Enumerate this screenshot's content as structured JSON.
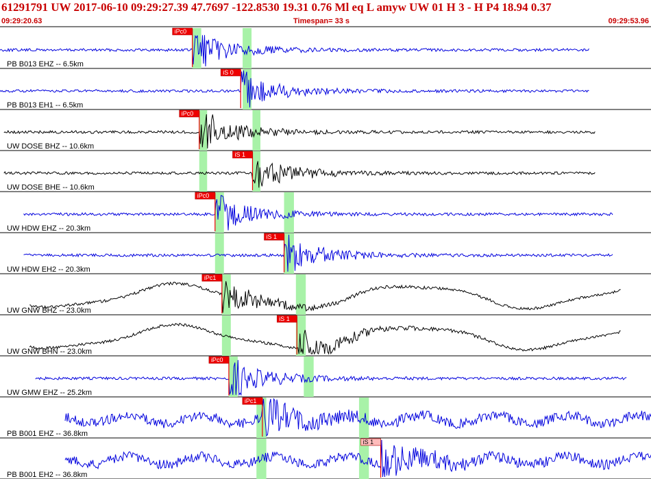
{
  "header": {
    "title": "61291791 UW 2017-06-10 09:29:27.39   47.7697 -122.8530  19.31  0.76 Ml  eq  L amyw     UW 01  H   3  -  H P4   18.94  0.37",
    "start_time": "09:29:20.63",
    "timespan": "Timespan=  33 s",
    "end_time": "09:29:53.96"
  },
  "colors": {
    "blue": "#0000dd",
    "black": "#000000",
    "pick_red": "#ee0000",
    "pick_pink": "#ffbbbb",
    "green_band": "#a8f2a8",
    "header_red": "#c80000"
  },
  "chart_data": {
    "type": "seismogram",
    "time_start": "09:29:20.63",
    "time_end": "09:29:53.96",
    "timespan_s": 33,
    "traces": [
      {
        "label": "PB B013 EHZ -- 6.5km",
        "color": "blue",
        "trace_start_s": 0.0,
        "trace_end_s": 29.9,
        "picks": [
          {
            "label": "iPc0",
            "t": 9.75,
            "style": "red"
          }
        ],
        "windows": [
          [
            9.75,
            10.2
          ],
          [
            12.3,
            12.75
          ]
        ]
      },
      {
        "label": "PB B013 EH1 -- 6.5km",
        "color": "blue",
        "trace_start_s": 0.0,
        "trace_end_s": 29.9,
        "picks": [
          {
            "label": "iS 0",
            "t": 12.2,
            "style": "red"
          }
        ],
        "windows": [
          [
            12.3,
            12.75
          ]
        ]
      },
      {
        "label": "UW DOSE BHZ -- 10.6km",
        "color": "black",
        "trace_start_s": 0.2,
        "trace_end_s": 30.2,
        "picks": [
          {
            "label": "iPc0",
            "t": 10.1,
            "style": "red"
          }
        ],
        "windows": [
          [
            10.1,
            10.5
          ],
          [
            12.8,
            13.2
          ]
        ]
      },
      {
        "label": "UW DOSE BHE -- 10.6km",
        "color": "black",
        "trace_start_s": 0.2,
        "trace_end_s": 30.2,
        "picks": [
          {
            "label": "iS 1",
            "t": 12.8,
            "style": "red"
          }
        ],
        "windows": [
          [
            10.1,
            10.5
          ],
          [
            12.8,
            13.2
          ]
        ]
      },
      {
        "label": "UW HDW EHZ -- 20.3km",
        "color": "blue",
        "trace_start_s": 1.2,
        "trace_end_s": 31.1,
        "picks": [
          {
            "label": "iPc0",
            "t": 10.9,
            "style": "red"
          }
        ],
        "windows": [
          [
            10.9,
            11.35
          ],
          [
            14.4,
            14.9
          ]
        ]
      },
      {
        "label": "UW HDW EH2 -- 20.3km",
        "color": "blue",
        "trace_start_s": 1.2,
        "trace_end_s": 31.1,
        "picks": [
          {
            "label": "iS 1",
            "t": 14.4,
            "style": "red"
          }
        ],
        "windows": [
          [
            10.9,
            11.35
          ],
          [
            14.4,
            14.9
          ]
        ]
      },
      {
        "label": "UW GNW BHZ -- 23.0km",
        "color": "black",
        "trace_start_s": 1.5,
        "trace_end_s": 31.5,
        "picks": [
          {
            "label": "iPc1",
            "t": 11.25,
            "style": "red"
          }
        ],
        "windows": [
          [
            11.25,
            11.7
          ],
          [
            15.0,
            15.5
          ]
        ]
      },
      {
        "label": "UW GNW BHN -- 23.0km",
        "color": "black",
        "trace_start_s": 1.5,
        "trace_end_s": 31.5,
        "picks": [
          {
            "label": "iS 1",
            "t": 15.05,
            "style": "red"
          }
        ],
        "windows": [
          [
            11.25,
            11.7
          ],
          [
            15.0,
            15.5
          ]
        ]
      },
      {
        "label": "UW GMW EHZ -- 25.2km",
        "color": "blue",
        "trace_start_s": 1.8,
        "trace_end_s": 31.8,
        "picks": [
          {
            "label": "iPc0",
            "t": 11.6,
            "style": "red"
          }
        ],
        "windows": [
          [
            11.6,
            12.05
          ],
          [
            15.4,
            15.9
          ]
        ]
      },
      {
        "label": "PB B001 EHZ -- 36.8km",
        "color": "blue",
        "trace_start_s": 3.3,
        "trace_end_s": 33.2,
        "picks": [
          {
            "label": "iPc1",
            "t": 13.3,
            "style": "red"
          }
        ],
        "windows": [
          [
            13.0,
            13.5
          ],
          [
            18.2,
            18.7
          ]
        ]
      },
      {
        "label": "PB B001 EH2 -- 36.8km",
        "color": "blue",
        "trace_start_s": 3.3,
        "trace_end_s": 33.2,
        "picks": [
          {
            "label": "iS 1",
            "t": 19.3,
            "style": "pink"
          }
        ],
        "windows": [
          [
            13.0,
            13.5
          ],
          [
            18.2,
            18.7
          ]
        ]
      }
    ]
  }
}
